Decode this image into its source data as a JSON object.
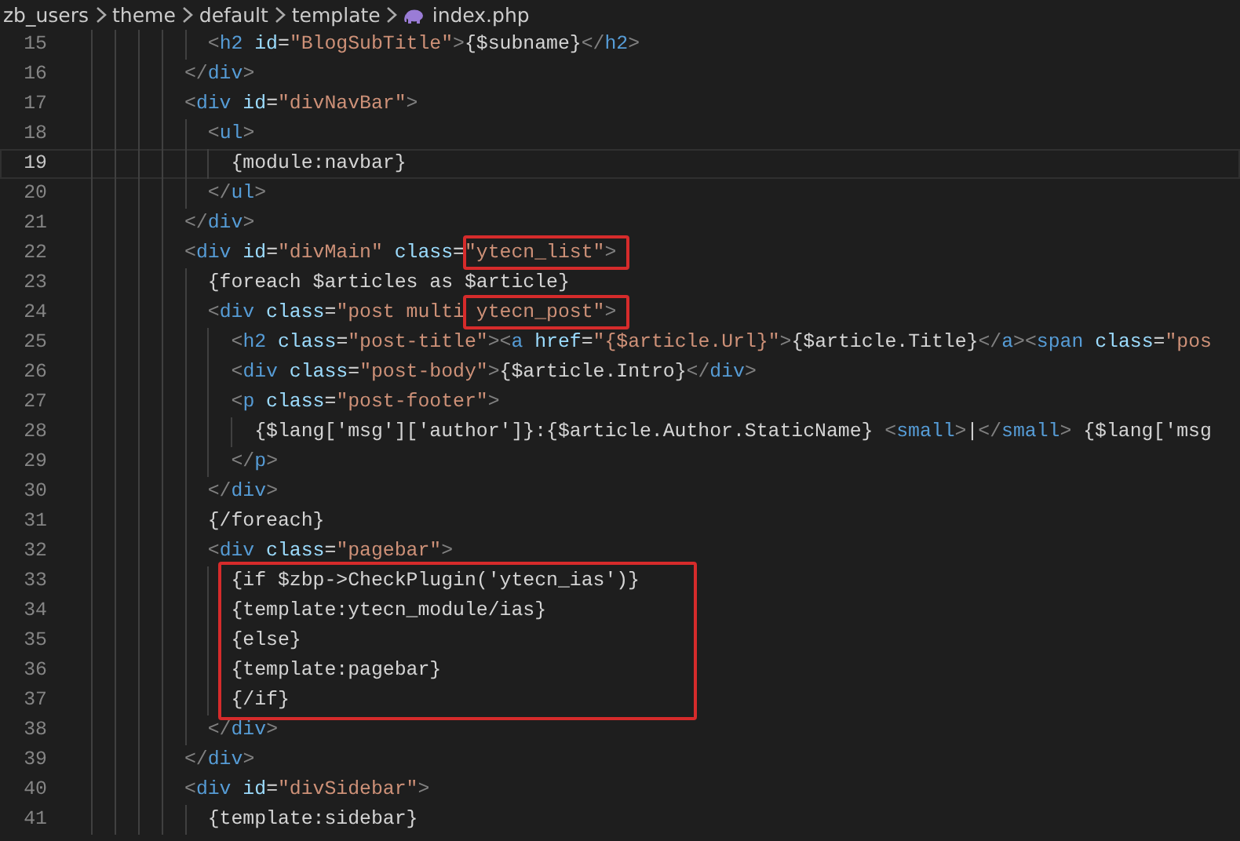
{
  "breadcrumb": {
    "segments": [
      "zb_users",
      "theme",
      "default",
      "template"
    ],
    "file": "index.php"
  },
  "lines": [
    {
      "number": "15",
      "current": false,
      "tokens": [
        {
          "kind": "punct",
          "text": "          <"
        },
        {
          "kind": "tag",
          "text": "h2"
        },
        {
          "kind": "attr",
          "text": " id"
        },
        {
          "kind": "text",
          "text": "="
        },
        {
          "kind": "str",
          "text": "\"BlogSubTitle\""
        },
        {
          "kind": "punct",
          "text": ">"
        },
        {
          "kind": "text",
          "text": "{$subname}"
        },
        {
          "kind": "punct",
          "text": "</"
        },
        {
          "kind": "tag",
          "text": "h2"
        },
        {
          "kind": "punct",
          "text": ">"
        }
      ]
    },
    {
      "number": "16",
      "current": false,
      "tokens": [
        {
          "kind": "punct",
          "text": "        </"
        },
        {
          "kind": "tag",
          "text": "div"
        },
        {
          "kind": "punct",
          "text": ">"
        }
      ]
    },
    {
      "number": "17",
      "current": false,
      "tokens": [
        {
          "kind": "punct",
          "text": "        <"
        },
        {
          "kind": "tag",
          "text": "div"
        },
        {
          "kind": "attr",
          "text": " id"
        },
        {
          "kind": "text",
          "text": "="
        },
        {
          "kind": "str",
          "text": "\"divNavBar\""
        },
        {
          "kind": "punct",
          "text": ">"
        }
      ]
    },
    {
      "number": "18",
      "current": false,
      "tokens": [
        {
          "kind": "punct",
          "text": "          <"
        },
        {
          "kind": "tag",
          "text": "ul"
        },
        {
          "kind": "punct",
          "text": ">"
        }
      ]
    },
    {
      "number": "19",
      "current": true,
      "tokens": [
        {
          "kind": "text",
          "text": "            {module:navbar}"
        }
      ]
    },
    {
      "number": "20",
      "current": false,
      "tokens": [
        {
          "kind": "punct",
          "text": "          </"
        },
        {
          "kind": "tag",
          "text": "ul"
        },
        {
          "kind": "punct",
          "text": ">"
        }
      ]
    },
    {
      "number": "21",
      "current": false,
      "tokens": [
        {
          "kind": "punct",
          "text": "        </"
        },
        {
          "kind": "tag",
          "text": "div"
        },
        {
          "kind": "punct",
          "text": ">"
        }
      ]
    },
    {
      "number": "22",
      "current": false,
      "tokens": [
        {
          "kind": "punct",
          "text": "        <"
        },
        {
          "kind": "tag",
          "text": "div"
        },
        {
          "kind": "attr",
          "text": " id"
        },
        {
          "kind": "text",
          "text": "="
        },
        {
          "kind": "str",
          "text": "\"divMain\""
        },
        {
          "kind": "attr",
          "text": " class"
        },
        {
          "kind": "text",
          "text": "="
        },
        {
          "kind": "str",
          "text": "\"ytecn_list\"",
          "boxed": true
        },
        {
          "kind": "punct",
          "text": ">",
          "boxed": true
        }
      ]
    },
    {
      "number": "23",
      "current": false,
      "tokens": [
        {
          "kind": "text",
          "text": "          {foreach $articles as $article}"
        }
      ]
    },
    {
      "number": "24",
      "current": false,
      "tokens": [
        {
          "kind": "punct",
          "text": "          <"
        },
        {
          "kind": "tag",
          "text": "div"
        },
        {
          "kind": "attr",
          "text": " class"
        },
        {
          "kind": "text",
          "text": "="
        },
        {
          "kind": "str",
          "text": "\"post multi"
        },
        {
          "kind": "str",
          "text": " ytecn_post\"",
          "boxed": true
        },
        {
          "kind": "punct",
          "text": ">",
          "boxed": true
        }
      ]
    },
    {
      "number": "25",
      "current": false,
      "tokens": [
        {
          "kind": "punct",
          "text": "            <"
        },
        {
          "kind": "tag",
          "text": "h2"
        },
        {
          "kind": "attr",
          "text": " class"
        },
        {
          "kind": "text",
          "text": "="
        },
        {
          "kind": "str",
          "text": "\"post-title\""
        },
        {
          "kind": "punct",
          "text": "><"
        },
        {
          "kind": "tag",
          "text": "a"
        },
        {
          "kind": "attr",
          "text": " href"
        },
        {
          "kind": "text",
          "text": "="
        },
        {
          "kind": "str",
          "text": "\"{$article.Url}\""
        },
        {
          "kind": "punct",
          "text": ">"
        },
        {
          "kind": "text",
          "text": "{$article.Title}"
        },
        {
          "kind": "punct",
          "text": "</"
        },
        {
          "kind": "tag",
          "text": "a"
        },
        {
          "kind": "punct",
          "text": "><"
        },
        {
          "kind": "tag",
          "text": "span"
        },
        {
          "kind": "attr",
          "text": " class"
        },
        {
          "kind": "text",
          "text": "="
        },
        {
          "kind": "str",
          "text": "\"pos"
        }
      ]
    },
    {
      "number": "26",
      "current": false,
      "tokens": [
        {
          "kind": "punct",
          "text": "            <"
        },
        {
          "kind": "tag",
          "text": "div"
        },
        {
          "kind": "attr",
          "text": " class"
        },
        {
          "kind": "text",
          "text": "="
        },
        {
          "kind": "str",
          "text": "\"post-body\""
        },
        {
          "kind": "punct",
          "text": ">"
        },
        {
          "kind": "text",
          "text": "{$article.Intro}"
        },
        {
          "kind": "punct",
          "text": "</"
        },
        {
          "kind": "tag",
          "text": "div"
        },
        {
          "kind": "punct",
          "text": ">"
        }
      ]
    },
    {
      "number": "27",
      "current": false,
      "tokens": [
        {
          "kind": "punct",
          "text": "            <"
        },
        {
          "kind": "tag",
          "text": "p"
        },
        {
          "kind": "attr",
          "text": " class"
        },
        {
          "kind": "text",
          "text": "="
        },
        {
          "kind": "str",
          "text": "\"post-footer\""
        },
        {
          "kind": "punct",
          "text": ">"
        }
      ]
    },
    {
      "number": "28",
      "current": false,
      "tokens": [
        {
          "kind": "text",
          "text": "              {$lang['msg']['author']}:{$article.Author.StaticName} "
        },
        {
          "kind": "punct",
          "text": "<"
        },
        {
          "kind": "tag",
          "text": "small"
        },
        {
          "kind": "punct",
          "text": ">"
        },
        {
          "kind": "text",
          "text": "|"
        },
        {
          "kind": "punct",
          "text": "</"
        },
        {
          "kind": "tag",
          "text": "small"
        },
        {
          "kind": "punct",
          "text": ">"
        },
        {
          "kind": "text",
          "text": " {$lang['msg"
        }
      ]
    },
    {
      "number": "29",
      "current": false,
      "tokens": [
        {
          "kind": "punct",
          "text": "            </"
        },
        {
          "kind": "tag",
          "text": "p"
        },
        {
          "kind": "punct",
          "text": ">"
        }
      ]
    },
    {
      "number": "30",
      "current": false,
      "tokens": [
        {
          "kind": "punct",
          "text": "          </"
        },
        {
          "kind": "tag",
          "text": "div"
        },
        {
          "kind": "punct",
          "text": ">"
        }
      ]
    },
    {
      "number": "31",
      "current": false,
      "tokens": [
        {
          "kind": "text",
          "text": "          {/foreach}"
        }
      ]
    },
    {
      "number": "32",
      "current": false,
      "tokens": [
        {
          "kind": "punct",
          "text": "          <"
        },
        {
          "kind": "tag",
          "text": "div"
        },
        {
          "kind": "attr",
          "text": " class"
        },
        {
          "kind": "text",
          "text": "="
        },
        {
          "kind": "str",
          "text": "\"pagebar\""
        },
        {
          "kind": "punct",
          "text": ">"
        }
      ]
    },
    {
      "number": "33",
      "current": false,
      "boxed": true,
      "tokens": [
        {
          "kind": "text",
          "text": "            {if $zbp->CheckPlugin('ytecn_ias')}"
        }
      ]
    },
    {
      "number": "34",
      "current": false,
      "boxed": true,
      "tokens": [
        {
          "kind": "text",
          "text": "            {template:ytecn_module/ias}"
        }
      ]
    },
    {
      "number": "35",
      "current": false,
      "boxed": true,
      "tokens": [
        {
          "kind": "text",
          "text": "            {else}"
        }
      ]
    },
    {
      "number": "36",
      "current": false,
      "boxed": true,
      "tokens": [
        {
          "kind": "text",
          "text": "            {template:pagebar}"
        }
      ]
    },
    {
      "number": "37",
      "current": false,
      "boxed": true,
      "tokens": [
        {
          "kind": "text",
          "text": "            {/if}"
        }
      ]
    },
    {
      "number": "38",
      "current": false,
      "tokens": [
        {
          "kind": "punct",
          "text": "          </"
        },
        {
          "kind": "tag",
          "text": "div"
        },
        {
          "kind": "punct",
          "text": ">"
        }
      ]
    },
    {
      "number": "39",
      "current": false,
      "tokens": [
        {
          "kind": "punct",
          "text": "        </"
        },
        {
          "kind": "tag",
          "text": "div"
        },
        {
          "kind": "punct",
          "text": ">"
        }
      ]
    },
    {
      "number": "40",
      "current": false,
      "tokens": [
        {
          "kind": "punct",
          "text": "        <"
        },
        {
          "kind": "tag",
          "text": "div"
        },
        {
          "kind": "attr",
          "text": " id"
        },
        {
          "kind": "text",
          "text": "="
        },
        {
          "kind": "str",
          "text": "\"divSidebar\""
        },
        {
          "kind": "punct",
          "text": ">"
        }
      ]
    },
    {
      "number": "41",
      "current": false,
      "tokens": [
        {
          "kind": "text",
          "text": "          {template:sidebar}"
        }
      ]
    }
  ]
}
